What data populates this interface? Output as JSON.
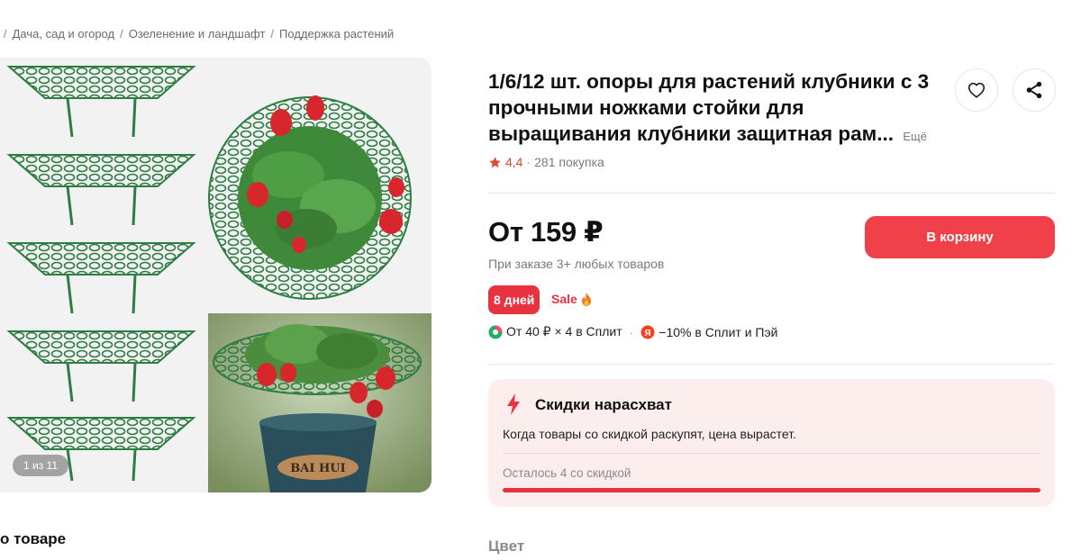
{
  "breadcrumb": [
    "Дача, сад и огород",
    "Озеленение и ландшафт",
    "Поддержка растений"
  ],
  "gallery": {
    "counter": "1 из 11",
    "watermark": "BAI HUI"
  },
  "about_heading": "о товаре",
  "product": {
    "title": "1/6/12 шт. опоры для растений клубники с 3 прочными ножками стойки для выращивания клубники защитная рам...",
    "more": "Ещё",
    "rating": "4,4",
    "purchases": "281 покупка",
    "price": "От 159 ₽",
    "price_note": "При заказе 3+ любых товаров",
    "cart_label": "В корзину",
    "days_badge": "8 дней",
    "sale_label": "Sale",
    "split_text": "От 40 ₽ × 4 в Сплит",
    "pay_text": "−10% в Сплит и Пэй"
  },
  "promo": {
    "title": "Скидки нарасхват",
    "text": "Когда товары со скидкой раскупят, цена вырастет.",
    "remaining": "Осталось 4 со скидкой",
    "progress": 1.0
  },
  "color_label": "Цвет",
  "colors": {
    "accent": "#f0414a",
    "badge": "#e8323f",
    "promo_bg": "#fdeeee",
    "plant_green": "#2e7d43"
  },
  "icons": [
    "heart-icon",
    "share-icon",
    "star-icon",
    "lightning-icon",
    "flame-icon",
    "split-icon",
    "yandex-pay-icon"
  ]
}
